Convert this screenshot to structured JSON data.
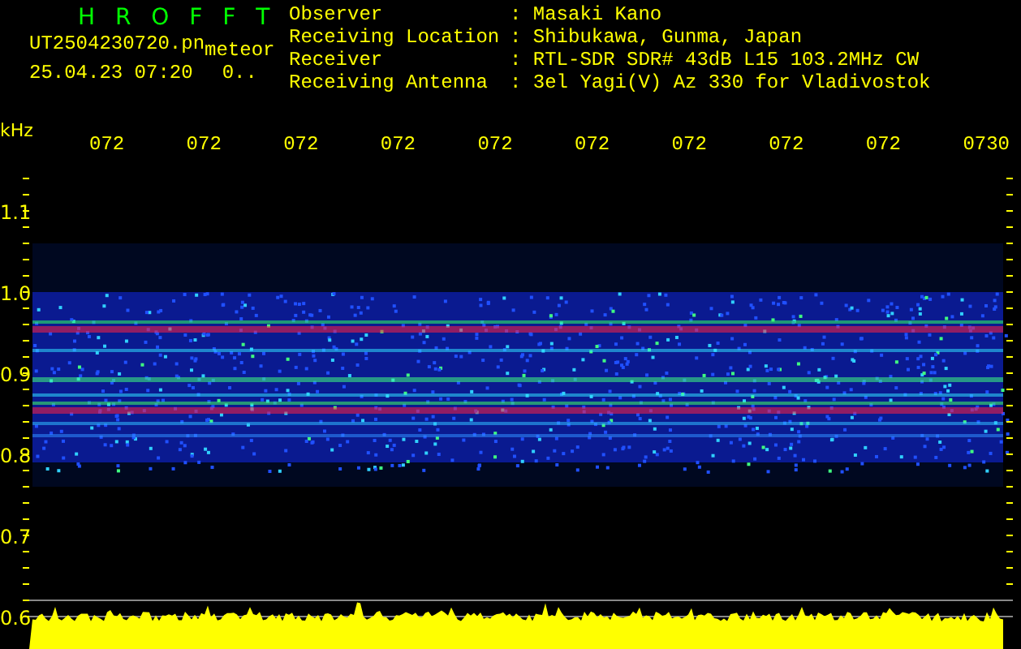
{
  "header": {
    "title": "H R O F F T",
    "file_name": "UT2504230720.pn",
    "tag": "meteor",
    "timestamp": "25.04.23 07:20",
    "count": "0..",
    "info": [
      {
        "label": "Observer",
        "value": ": Masaki Kano"
      },
      {
        "label": "Receiving Location",
        "value": ": Shibukawa, Gunma, Japan"
      },
      {
        "label": "Receiver",
        "value": ": RTL-SDR SDR# 43dB L15 103.2MHz CW"
      },
      {
        "label": "Receiving Antenna",
        "value": ": 3el Yagi(V) Az 330 for Vladivostok"
      }
    ]
  },
  "plot": {
    "unit": "kHz",
    "time_labels": [
      "072",
      "072",
      "072",
      "072",
      "072",
      "072",
      "072",
      "072",
      "072",
      "0730"
    ],
    "freq_labels": [
      "1.1",
      "1.0",
      "0.9",
      "0.8",
      "0.7",
      "0.6"
    ]
  }
}
